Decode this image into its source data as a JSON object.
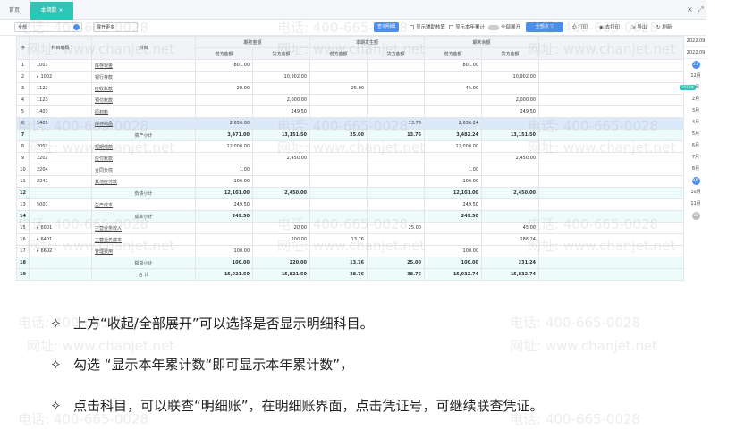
{
  "tabs": {
    "home": "首页",
    "active": "本期数 ×"
  },
  "window_controls": {
    "close": "×",
    "expand": "⤢"
  },
  "toolbar": {
    "org_select": "全部",
    "expand_label": "展开更多",
    "query_button": "查询明细",
    "show_aux": "显示辅助核算",
    "show_year_total": "显示本年累计",
    "all_expand": "全部展开",
    "collapse_button": "全部点 ▽",
    "print": "打印",
    "hang": "去打印",
    "export": "导出",
    "refresh": "刷新"
  },
  "table": {
    "header_top": {
      "seq": "序",
      "code": "科目编码",
      "name": "科目",
      "opening": "期初金额",
      "current": "本期发生额",
      "closing": "期末余额"
    },
    "header_sub": {
      "debit": "借方金额",
      "credit": "贷方金额"
    },
    "rows": [
      {
        "no": "1",
        "code": "1001",
        "caret": "",
        "name": "库存现金",
        "od": "801.00",
        "oc": "",
        "cd": "",
        "cc": "",
        "ed": "801.00",
        "ec": "",
        "type": "detail"
      },
      {
        "no": "2",
        "code": "1002",
        "caret": "▸",
        "name": "银行存款",
        "od": "",
        "oc": "10,902.00",
        "cd": "",
        "cc": "",
        "ed": "",
        "ec": "10,902.00",
        "type": "detail"
      },
      {
        "no": "3",
        "code": "1122",
        "caret": "",
        "name": "应收账款",
        "od": "20.00",
        "oc": "",
        "cd": "25.00",
        "cc": "",
        "ed": "45.00",
        "ec": "",
        "type": "detail"
      },
      {
        "no": "4",
        "code": "1123",
        "caret": "",
        "name": "预付账款",
        "od": "",
        "oc": "2,000.00",
        "cd": "",
        "cc": "",
        "ed": "",
        "ec": "2,000.00",
        "type": "detail"
      },
      {
        "no": "5",
        "code": "1403",
        "caret": "",
        "name": "原材料",
        "od": "",
        "oc": "249.50",
        "cd": "",
        "cc": "",
        "ed": "",
        "ec": "249.50",
        "type": "detail"
      },
      {
        "no": "6",
        "code": "1405",
        "caret": "",
        "name": "库存商品",
        "od": "2,650.00",
        "oc": "",
        "cd": "",
        "cc": "13.76",
        "ed": "2,636.24",
        "ec": "",
        "type": "highlight"
      },
      {
        "no": "7",
        "code": "",
        "caret": "",
        "name": "资产小计",
        "od": "3,471.00",
        "oc": "13,151.50",
        "cd": "25.00",
        "cc": "13.76",
        "ed": "3,482.24",
        "ec": "13,151.50",
        "type": "sub"
      },
      {
        "no": "8",
        "code": "2001",
        "caret": "",
        "name": "短期借款",
        "od": "12,000.00",
        "oc": "",
        "cd": "",
        "cc": "",
        "ed": "12,000.00",
        "ec": "",
        "type": "detail"
      },
      {
        "no": "9",
        "code": "2202",
        "caret": "",
        "name": "应付账款",
        "od": "",
        "oc": "2,450.00",
        "cd": "",
        "cc": "",
        "ed": "",
        "ec": "2,450.00",
        "type": "detail"
      },
      {
        "no": "10",
        "code": "2204",
        "caret": "",
        "name": "合同负债",
        "od": "1.00",
        "oc": "",
        "cd": "",
        "cc": "",
        "ed": "1.00",
        "ec": "",
        "type": "detail"
      },
      {
        "no": "11",
        "code": "2241",
        "caret": "",
        "name": "其他应付款",
        "od": "100.00",
        "oc": "",
        "cd": "",
        "cc": "",
        "ed": "100.00",
        "ec": "",
        "type": "detail"
      },
      {
        "no": "12",
        "code": "",
        "caret": "",
        "name": "负债小计",
        "od": "12,101.00",
        "oc": "2,450.00",
        "cd": "",
        "cc": "",
        "ed": "12,101.00",
        "ec": "2,450.00",
        "type": "sub"
      },
      {
        "no": "13",
        "code": "5001",
        "caret": "",
        "name": "生产成本",
        "od": "249.50",
        "oc": "",
        "cd": "",
        "cc": "",
        "ed": "249.50",
        "ec": "",
        "type": "detail"
      },
      {
        "no": "14",
        "code": "",
        "caret": "",
        "name": "成本小计",
        "od": "249.50",
        "oc": "",
        "cd": "",
        "cc": "",
        "ed": "249.50",
        "ec": "",
        "type": "sub"
      },
      {
        "no": "15",
        "code": "6001",
        "caret": "▸",
        "name": "主营业务收入",
        "od": "",
        "oc": "20.00",
        "cd": "",
        "cc": "25.00",
        "ed": "",
        "ec": "45.00",
        "type": "detail"
      },
      {
        "no": "16",
        "code": "6401",
        "caret": "▸",
        "name": "主营业务成本",
        "od": "",
        "oc": "200.00",
        "cd": "13.76",
        "cc": "",
        "ed": "",
        "ec": "186.24",
        "type": "detail"
      },
      {
        "no": "17",
        "code": "6602",
        "caret": "▸",
        "name": "管理费用",
        "od": "100.00",
        "oc": "",
        "cd": "",
        "cc": "",
        "ed": "100.00",
        "ec": "",
        "type": "detail"
      },
      {
        "no": "18",
        "code": "",
        "caret": "",
        "name": "损益小计",
        "od": "100.00",
        "oc": "220.00",
        "cd": "13.76",
        "cc": "25.00",
        "ed": "100.00",
        "ec": "231.24",
        "type": "sub"
      },
      {
        "no": "19",
        "code": "",
        "caret": "",
        "name": "合 计",
        "od": "15,921.50",
        "oc": "15,821.50",
        "cd": "38.76",
        "cc": "38.76",
        "ed": "15,932.74",
        "ec": "15,832.74",
        "type": "sub"
      }
    ]
  },
  "period_panel": {
    "date_from": "2022.09",
    "date_to": "2022.09",
    "tag": "2022年",
    "months": [
      {
        "label": "21",
        "style": "dot"
      },
      {
        "label": "12月",
        "style": "text"
      },
      {
        "label": "1月",
        "style": "text"
      },
      {
        "label": "2月",
        "style": "text"
      },
      {
        "label": "3月",
        "style": "text"
      },
      {
        "label": "4月",
        "style": "text"
      },
      {
        "label": "5月",
        "style": "text"
      },
      {
        "label": "6月",
        "style": "text"
      },
      {
        "label": "7月",
        "style": "text"
      },
      {
        "label": "8月",
        "style": "text"
      },
      {
        "label": "9月",
        "style": "dot"
      },
      {
        "label": "10月",
        "style": "text"
      },
      {
        "label": "11月",
        "style": "text"
      },
      {
        "label": "22",
        "style": "dot-grey"
      }
    ]
  },
  "watermark": {
    "phone": "电话: 400-665-0028",
    "site": "网址: www.chanjet.net"
  },
  "notes": [
    {
      "bullet": "✧",
      "text": "上方“收起/全部展开”可以选择是否显示明细科目。"
    },
    {
      "bullet": "✧",
      "text": "勾选 “显示本年累计数“即可显示本年累计数”，"
    },
    {
      "bullet": "✧",
      "text": "点击科目，可以联查“明细账”，在明细账界面，点击凭证号，可继续联查凭证。"
    }
  ]
}
